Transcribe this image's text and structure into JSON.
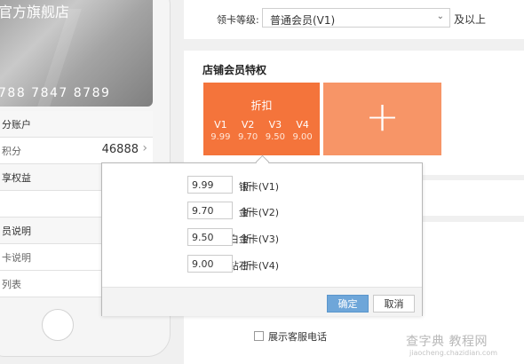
{
  "phone": {
    "card_title": "官方旗舰店",
    "card_number": "788 7847 8789",
    "rows": [
      {
        "text": "分账户"
      },
      {
        "text": "积分",
        "value": "46888"
      },
      {
        "text": "享权益"
      },
      {
        "text": ""
      },
      {
        "text": "员说明"
      },
      {
        "text": "卡说明"
      },
      {
        "text": "列表"
      }
    ]
  },
  "level": {
    "label": "领卡等级:",
    "selected": "普通会员(V1)",
    "suffix": "及以上"
  },
  "privileges": {
    "title": "店铺会员特权",
    "discount_tile": {
      "title": "折扣",
      "levels": [
        "V1",
        "V2",
        "V3",
        "V4"
      ],
      "rates": [
        "9.99",
        "9.70",
        "9.50",
        "9.00"
      ]
    },
    "add_symbol": "+"
  },
  "popup": {
    "rows": [
      {
        "label": "银卡(V1)",
        "value": "9.99",
        "unit": "折"
      },
      {
        "label": "金卡(V2)",
        "value": "9.70",
        "unit": "折"
      },
      {
        "label": "白金卡(V3)",
        "value": "9.50",
        "unit": "折"
      },
      {
        "label": "钻石卡(V4)",
        "value": "9.00",
        "unit": "折"
      }
    ],
    "confirm_label": "确定",
    "cancel_label": "取消"
  },
  "show_phone_label": "展示客服电话",
  "watermark": {
    "text": "查字典 教程网",
    "sub": "jiaocheng.chazidian.com"
  },
  "colors": {
    "discount_tile": "#f4743b",
    "add_tile": "#f79567",
    "confirm_button": "#6ea6d9"
  }
}
